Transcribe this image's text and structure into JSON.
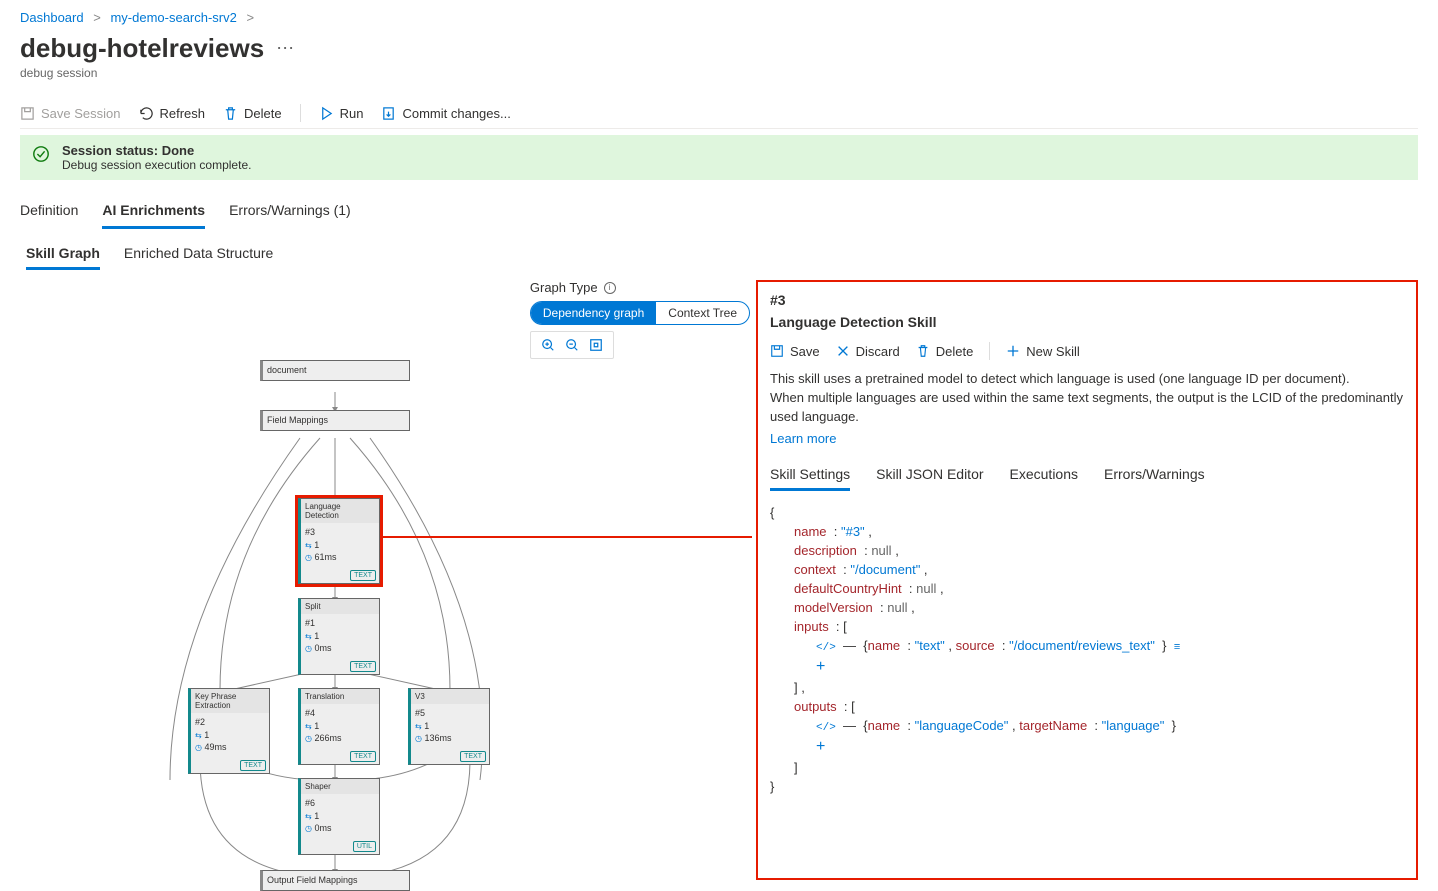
{
  "breadcrumb": {
    "dashboard": "Dashboard",
    "resource": "my-demo-search-srv2"
  },
  "title": "debug-hotelreviews",
  "subtitle": "debug session",
  "toolbar": {
    "save": "Save Session",
    "refresh": "Refresh",
    "delete": "Delete",
    "run": "Run",
    "commit": "Commit changes..."
  },
  "status": {
    "title": "Session status: Done",
    "sub": "Debug session execution complete."
  },
  "tabs": {
    "definition": "Definition",
    "enrich": "AI Enrichments",
    "errors": "Errors/Warnings (1)"
  },
  "subtabs": {
    "graph": "Skill Graph",
    "data": "Enriched Data Structure"
  },
  "graphtype": {
    "label": "Graph Type",
    "dep": "Dependency graph",
    "ctx": "Context Tree"
  },
  "nodes": {
    "doc": {
      "label": "document"
    },
    "fm": {
      "label": "Field Mappings"
    },
    "lang": {
      "label": "Language Detection",
      "id": "#3",
      "count": "1",
      "time": "61ms",
      "badge": "TEXT"
    },
    "split": {
      "label": "Split",
      "id": "#1",
      "count": "1",
      "time": "0ms",
      "badge": "TEXT"
    },
    "kpe": {
      "label": "Key Phrase Extraction",
      "id": "#2",
      "count": "1",
      "time": "49ms",
      "badge": "TEXT"
    },
    "trans": {
      "label": "Translation",
      "id": "#4",
      "count": "1",
      "time": "266ms",
      "badge": "TEXT"
    },
    "v3": {
      "label": "V3",
      "id": "#5",
      "count": "1",
      "time": "136ms",
      "badge": "TEXT"
    },
    "shaper": {
      "label": "Shaper",
      "id": "#6",
      "count": "1",
      "time": "0ms",
      "badge": "UTIL"
    },
    "ofm": {
      "label": "Output Field Mappings"
    }
  },
  "detail": {
    "id": "#3",
    "name": "Language Detection Skill",
    "btns": {
      "save": "Save",
      "discard": "Discard",
      "delete": "Delete",
      "new": "New Skill"
    },
    "desc1": "This skill uses a pretrained model to detect which language is used (one language ID per document).",
    "desc2": "When multiple languages are used within the same text segments, the output is the LCID of the predominantly used language.",
    "learn": "Learn more",
    "tabs": {
      "settings": "Skill Settings",
      "json": "Skill JSON Editor",
      "exec": "Executions",
      "err": "Errors/Warnings"
    },
    "json": {
      "name_k": "name",
      "name_v": "\"#3\"",
      "desc_k": "description",
      "desc_v": "null",
      "ctx_k": "context",
      "ctx_v": "\"/document\"",
      "dch_k": "defaultCountryHint",
      "dch_v": "null",
      "mv_k": "modelVersion",
      "mv_v": "null",
      "inputs_k": "inputs",
      "in_name_k": "name",
      "in_name_v": "\"text\"",
      "in_src_k": "source",
      "in_src_v": "\"/document/reviews_text\"",
      "outputs_k": "outputs",
      "out_name_k": "name",
      "out_name_v": "\"languageCode\"",
      "out_tn_k": "targetName",
      "out_tn_v": "\"language\""
    }
  }
}
